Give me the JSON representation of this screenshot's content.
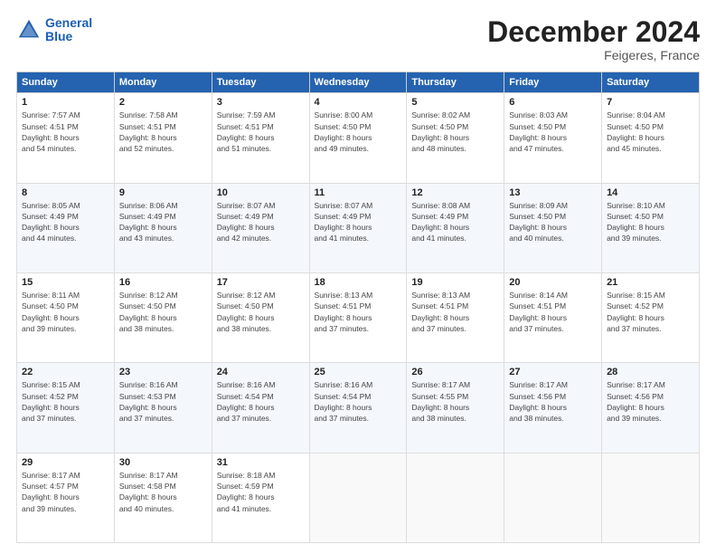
{
  "logo": {
    "line1": "General",
    "line2": "Blue"
  },
  "title": "December 2024",
  "subtitle": "Feigeres, France",
  "headers": [
    "Sunday",
    "Monday",
    "Tuesday",
    "Wednesday",
    "Thursday",
    "Friday",
    "Saturday"
  ],
  "weeks": [
    [
      {
        "day": "1",
        "info": "Sunrise: 7:57 AM\nSunset: 4:51 PM\nDaylight: 8 hours\nand 54 minutes."
      },
      {
        "day": "2",
        "info": "Sunrise: 7:58 AM\nSunset: 4:51 PM\nDaylight: 8 hours\nand 52 minutes."
      },
      {
        "day": "3",
        "info": "Sunrise: 7:59 AM\nSunset: 4:51 PM\nDaylight: 8 hours\nand 51 minutes."
      },
      {
        "day": "4",
        "info": "Sunrise: 8:00 AM\nSunset: 4:50 PM\nDaylight: 8 hours\nand 49 minutes."
      },
      {
        "day": "5",
        "info": "Sunrise: 8:02 AM\nSunset: 4:50 PM\nDaylight: 8 hours\nand 48 minutes."
      },
      {
        "day": "6",
        "info": "Sunrise: 8:03 AM\nSunset: 4:50 PM\nDaylight: 8 hours\nand 47 minutes."
      },
      {
        "day": "7",
        "info": "Sunrise: 8:04 AM\nSunset: 4:50 PM\nDaylight: 8 hours\nand 45 minutes."
      }
    ],
    [
      {
        "day": "8",
        "info": "Sunrise: 8:05 AM\nSunset: 4:49 PM\nDaylight: 8 hours\nand 44 minutes."
      },
      {
        "day": "9",
        "info": "Sunrise: 8:06 AM\nSunset: 4:49 PM\nDaylight: 8 hours\nand 43 minutes."
      },
      {
        "day": "10",
        "info": "Sunrise: 8:07 AM\nSunset: 4:49 PM\nDaylight: 8 hours\nand 42 minutes."
      },
      {
        "day": "11",
        "info": "Sunrise: 8:07 AM\nSunset: 4:49 PM\nDaylight: 8 hours\nand 41 minutes."
      },
      {
        "day": "12",
        "info": "Sunrise: 8:08 AM\nSunset: 4:49 PM\nDaylight: 8 hours\nand 41 minutes."
      },
      {
        "day": "13",
        "info": "Sunrise: 8:09 AM\nSunset: 4:50 PM\nDaylight: 8 hours\nand 40 minutes."
      },
      {
        "day": "14",
        "info": "Sunrise: 8:10 AM\nSunset: 4:50 PM\nDaylight: 8 hours\nand 39 minutes."
      }
    ],
    [
      {
        "day": "15",
        "info": "Sunrise: 8:11 AM\nSunset: 4:50 PM\nDaylight: 8 hours\nand 39 minutes."
      },
      {
        "day": "16",
        "info": "Sunrise: 8:12 AM\nSunset: 4:50 PM\nDaylight: 8 hours\nand 38 minutes."
      },
      {
        "day": "17",
        "info": "Sunrise: 8:12 AM\nSunset: 4:50 PM\nDaylight: 8 hours\nand 38 minutes."
      },
      {
        "day": "18",
        "info": "Sunrise: 8:13 AM\nSunset: 4:51 PM\nDaylight: 8 hours\nand 37 minutes."
      },
      {
        "day": "19",
        "info": "Sunrise: 8:13 AM\nSunset: 4:51 PM\nDaylight: 8 hours\nand 37 minutes."
      },
      {
        "day": "20",
        "info": "Sunrise: 8:14 AM\nSunset: 4:51 PM\nDaylight: 8 hours\nand 37 minutes."
      },
      {
        "day": "21",
        "info": "Sunrise: 8:15 AM\nSunset: 4:52 PM\nDaylight: 8 hours\nand 37 minutes."
      }
    ],
    [
      {
        "day": "22",
        "info": "Sunrise: 8:15 AM\nSunset: 4:52 PM\nDaylight: 8 hours\nand 37 minutes."
      },
      {
        "day": "23",
        "info": "Sunrise: 8:16 AM\nSunset: 4:53 PM\nDaylight: 8 hours\nand 37 minutes."
      },
      {
        "day": "24",
        "info": "Sunrise: 8:16 AM\nSunset: 4:54 PM\nDaylight: 8 hours\nand 37 minutes."
      },
      {
        "day": "25",
        "info": "Sunrise: 8:16 AM\nSunset: 4:54 PM\nDaylight: 8 hours\nand 37 minutes."
      },
      {
        "day": "26",
        "info": "Sunrise: 8:17 AM\nSunset: 4:55 PM\nDaylight: 8 hours\nand 38 minutes."
      },
      {
        "day": "27",
        "info": "Sunrise: 8:17 AM\nSunset: 4:56 PM\nDaylight: 8 hours\nand 38 minutes."
      },
      {
        "day": "28",
        "info": "Sunrise: 8:17 AM\nSunset: 4:56 PM\nDaylight: 8 hours\nand 39 minutes."
      }
    ],
    [
      {
        "day": "29",
        "info": "Sunrise: 8:17 AM\nSunset: 4:57 PM\nDaylight: 8 hours\nand 39 minutes."
      },
      {
        "day": "30",
        "info": "Sunrise: 8:17 AM\nSunset: 4:58 PM\nDaylight: 8 hours\nand 40 minutes."
      },
      {
        "day": "31",
        "info": "Sunrise: 8:18 AM\nSunset: 4:59 PM\nDaylight: 8 hours\nand 41 minutes."
      },
      {
        "day": "",
        "info": ""
      },
      {
        "day": "",
        "info": ""
      },
      {
        "day": "",
        "info": ""
      },
      {
        "day": "",
        "info": ""
      }
    ]
  ]
}
